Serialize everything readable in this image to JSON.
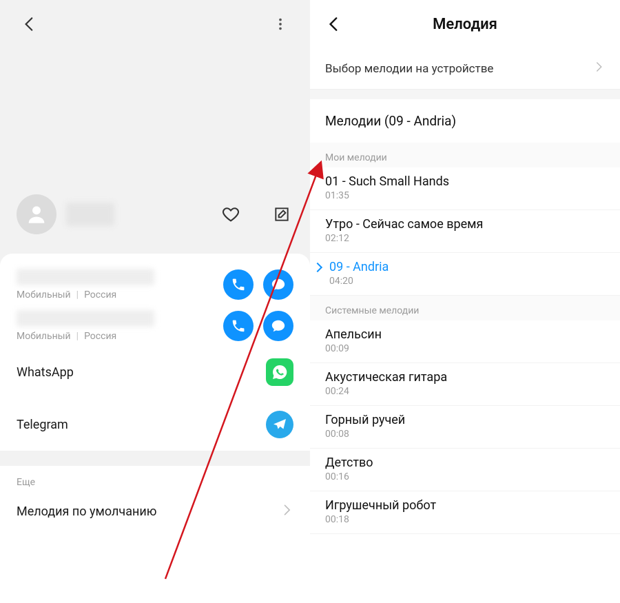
{
  "left": {
    "phone_meta_type": "Мобильный",
    "phone_meta_region": "Россия",
    "apps": {
      "whatsapp": "WhatsApp",
      "telegram": "Telegram"
    },
    "more_section": "Еще",
    "default_ringtone": "Мелодия по умолчанию"
  },
  "right": {
    "title": "Мелодия",
    "pick_on_device": "Выбор мелодии на устройстве",
    "current": "Мелодии (09 - Andria)",
    "cat_my": "Мои мелодии",
    "my": [
      {
        "title": "01 - Such Small Hands",
        "dur": "01:35",
        "selected": false
      },
      {
        "title": "Утро - Сейчас самое время",
        "dur": "02:12",
        "selected": false
      },
      {
        "title": "09 - Andria",
        "dur": "04:20",
        "selected": true
      }
    ],
    "cat_sys": "Системные мелодии",
    "sys": [
      {
        "title": "Апельсин",
        "dur": "00:09"
      },
      {
        "title": "Акустическая гитара",
        "dur": "00:24"
      },
      {
        "title": "Горный ручей",
        "dur": "00:08"
      },
      {
        "title": "Детство",
        "dur": "00:16"
      },
      {
        "title": "Игрушечный робот",
        "dur": "00:18"
      }
    ]
  }
}
